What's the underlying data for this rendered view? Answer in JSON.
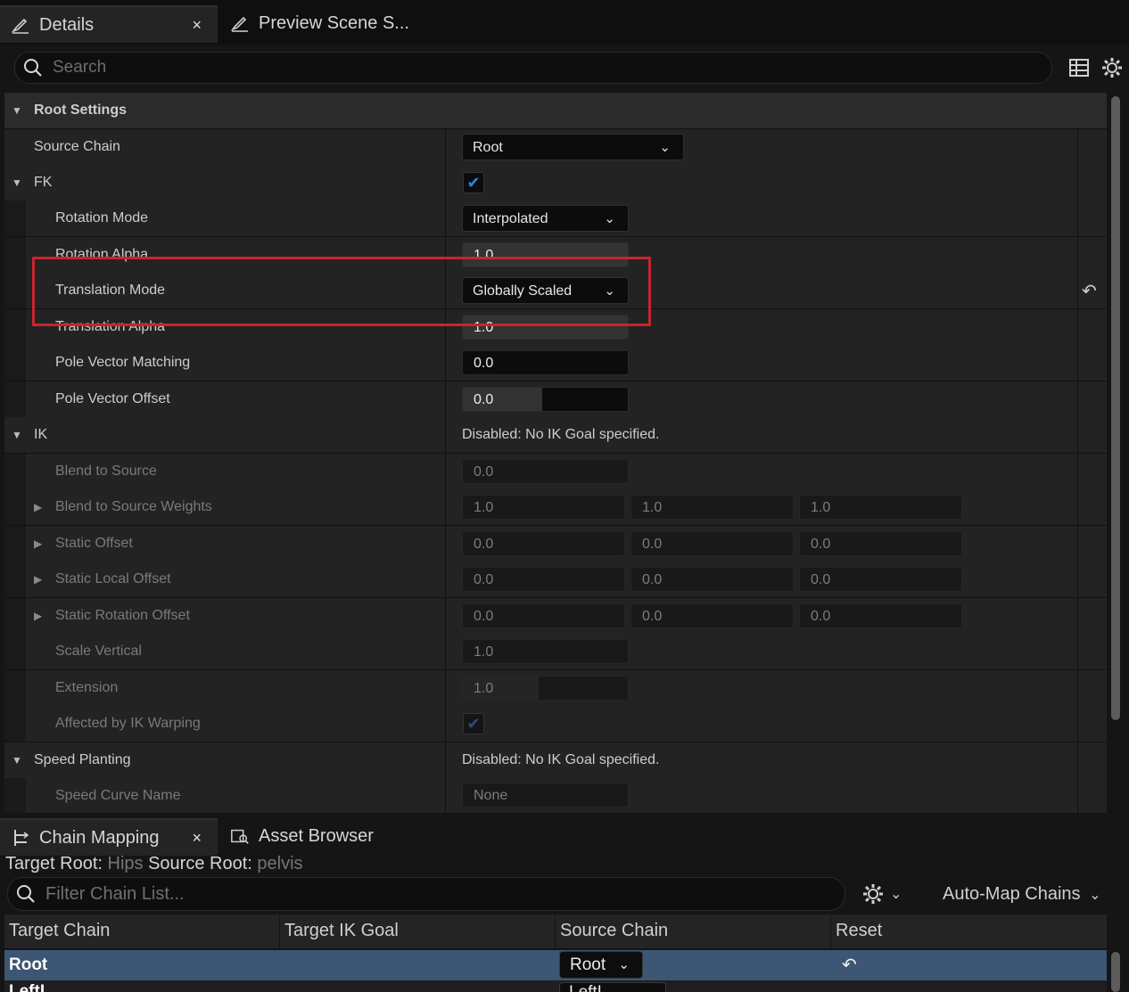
{
  "tabs_top": [
    {
      "label": "Details",
      "icon": "edit-icon",
      "active": true,
      "close": "×"
    },
    {
      "label": "Preview Scene S...",
      "icon": "edit-icon",
      "active": false
    }
  ],
  "search": {
    "placeholder": "Search"
  },
  "toolbar_icons": [
    "table-icon",
    "gear-icon"
  ],
  "details": {
    "root_settings": {
      "title": "Root Settings"
    },
    "source_chain": {
      "label": "Source Chain",
      "value": "Root"
    },
    "fk": {
      "title": "FK",
      "enabled": true
    },
    "rotation_mode": {
      "label": "Rotation Mode",
      "value": "Interpolated"
    },
    "rotation_alpha": {
      "label": "Rotation Alpha",
      "value": "1.0"
    },
    "translation_mode": {
      "label": "Translation Mode",
      "value": "Globally Scaled",
      "reset_icon": "↶"
    },
    "translation_alpha": {
      "label": "Translation Alpha",
      "value": "1.0"
    },
    "pole_vector_matching": {
      "label": "Pole Vector Matching",
      "value": "0.0"
    },
    "pole_vector_offset": {
      "label": "Pole Vector Offset",
      "value": "0.0"
    },
    "ik": {
      "title": "IK",
      "status": "Disabled: No IK Goal specified."
    },
    "blend_to_source": {
      "label": "Blend to Source",
      "value": "0.0"
    },
    "blend_to_source_weights": {
      "label": "Blend to Source Weights",
      "values": [
        "1.0",
        "1.0",
        "1.0"
      ]
    },
    "static_offset": {
      "label": "Static Offset",
      "values": [
        "0.0",
        "0.0",
        "0.0"
      ]
    },
    "static_local_offset": {
      "label": "Static Local Offset",
      "values": [
        "0.0",
        "0.0",
        "0.0"
      ]
    },
    "static_rotation_offset": {
      "label": "Static Rotation Offset",
      "values": [
        "0.0",
        "0.0",
        "0.0"
      ]
    },
    "scale_vertical": {
      "label": "Scale Vertical",
      "value": "1.0"
    },
    "extension": {
      "label": "Extension",
      "value": "1.0"
    },
    "affected_by_ik_warping": {
      "label": "Affected by IK Warping",
      "checked": true
    },
    "speed_planting": {
      "title": "Speed Planting",
      "status": "Disabled: No IK Goal specified."
    },
    "speed_curve_name": {
      "label": "Speed Curve Name",
      "value": "None"
    }
  },
  "tabs_bottom": [
    {
      "label": "Chain Mapping",
      "icon": "chain-mapping-icon",
      "active": true,
      "close": "×"
    },
    {
      "label": "Asset Browser",
      "icon": "asset-browser-icon",
      "active": false
    }
  ],
  "chain_mapping": {
    "target_root_label": "Target Root:",
    "target_root_value": "Hips",
    "source_root_label": "Source Root:",
    "source_root_value": "pelvis",
    "filter_placeholder": "Filter Chain List...",
    "auto_map_label": "Auto-Map Chains",
    "columns": [
      "Target Chain",
      "Target IK Goal",
      "Source Chain",
      "Reset"
    ],
    "rows": [
      {
        "target_chain": "Root",
        "target_ik_goal": "",
        "source_chain": "Root",
        "reset_icon": "↶",
        "selected": true
      },
      {
        "target_chain": "LeftL...",
        "source_chain": "LeftL..."
      }
    ]
  }
}
